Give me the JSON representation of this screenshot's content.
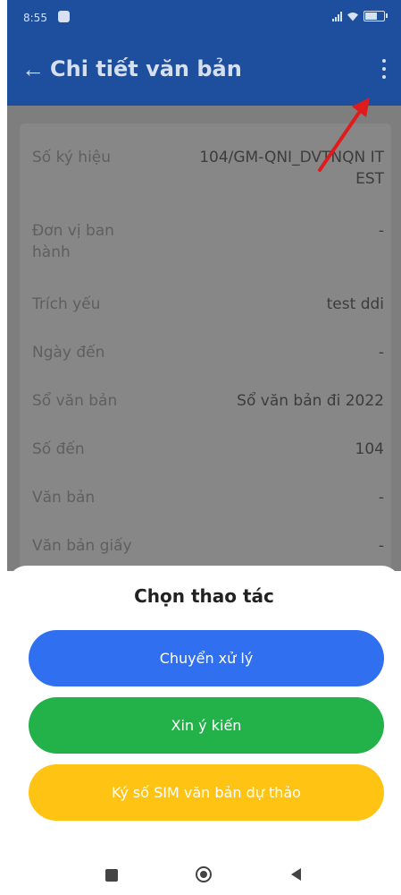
{
  "status_bar": {
    "time": "8:55"
  },
  "header": {
    "back_icon": "←",
    "title": "Chi tiết văn bản",
    "more_icon": "vertical-ellipsis-icon"
  },
  "details": [
    {
      "label": "Số ký hiệu",
      "value": "104/GM-QNI_DVTNQN ITEST"
    },
    {
      "label": "Đơn vị ban hành",
      "value": "-"
    },
    {
      "label": "Trích yếu",
      "value": "test ddi"
    },
    {
      "label": "Ngày đến",
      "value": "-"
    },
    {
      "label": "Sổ văn bản",
      "value": "Sổ văn bản đi 2022"
    },
    {
      "label": "Số đến",
      "value": "104"
    },
    {
      "label": "Văn bản",
      "value": "-"
    },
    {
      "label": "Văn bản giấy",
      "value": "-"
    }
  ],
  "sheet": {
    "title": "Chọn thao tác",
    "actions": [
      {
        "label": "Chuyển xử lý",
        "color": "#2f6ff0"
      },
      {
        "label": "Xin ý kiến",
        "color": "#23b24a"
      },
      {
        "label": "Ký số SIM văn bản dự thảo",
        "color": "#ffc313"
      }
    ]
  },
  "colors": {
    "appbar": "#1d4f9e",
    "overlay": "#7e7e7e",
    "annotation_arrow": "#e01b1b"
  }
}
